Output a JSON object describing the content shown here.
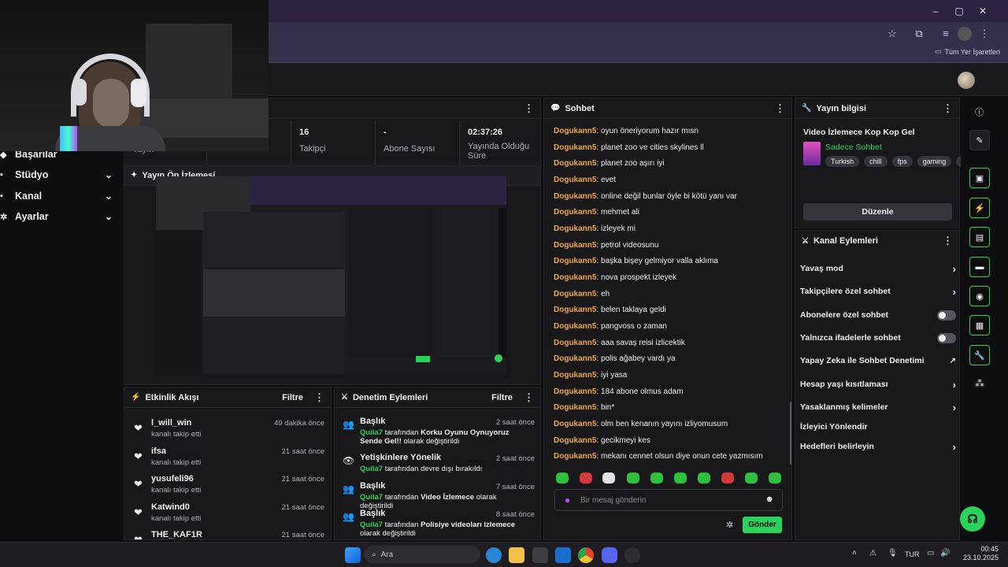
{
  "browser": {
    "bookmarks_label": "Tüm Yer İşaretleri",
    "minimize": "–",
    "maximize": "▢",
    "close": "✕"
  },
  "sidebar": {
    "items": [
      {
        "label": "Başarılar",
        "icon": "trophy-icon"
      },
      {
        "label": "Stüdyo",
        "icon": "studio-icon"
      },
      {
        "label": "Kanal",
        "icon": "channel-icon"
      },
      {
        "label": "Ayarlar",
        "icon": "gear-icon"
      }
    ]
  },
  "stats": {
    "items": [
      {
        "value": "",
        "label": "Yayın"
      },
      {
        "value": "16",
        "label": "Takipçi"
      },
      {
        "value": "-",
        "label": "Abone Sayısı"
      },
      {
        "value": "02:37:26",
        "label": "Yayında Olduğu Süre"
      }
    ]
  },
  "preview": {
    "title": "Yayın Ön İzlemesi"
  },
  "activity": {
    "title": "Etkinlik Akışı",
    "filter": "Filtre",
    "events": [
      {
        "name": "l_will_win",
        "sub": "kanalı takip etti",
        "time": "49 dakika önce"
      },
      {
        "name": "ifsa",
        "sub": "kanalı takip etti",
        "time": "21 saat önce"
      },
      {
        "name": "yusufeli96",
        "sub": "kanalı takip etti",
        "time": "21 saat önce"
      },
      {
        "name": "Katwind0",
        "sub": "kanalı takip etti",
        "time": "21 saat önce"
      },
      {
        "name": "THE_KAF1R",
        "sub": "",
        "time": "21 saat önce"
      }
    ]
  },
  "mod": {
    "title": "Denetim Eylemleri",
    "filter": "Filtre",
    "items": [
      {
        "title": "Başlık",
        "user": "Quila7",
        "by": "tarafından",
        "value": "Korku Oyunu Oynuyoruz Sende Gel!!",
        "tail": "olarak değiştirildi",
        "time": "2 saat önce"
      },
      {
        "title": "Yetişkinlere Yönelik",
        "user": "Quila7",
        "by": "tarafından devre dışı bırakıldı",
        "value": "",
        "tail": "",
        "time": "2 saat önce"
      },
      {
        "title": "Başlık",
        "user": "Quila7",
        "by": "tarafından",
        "value": "Video İzlemece",
        "tail": "olarak değiştirildi",
        "time": "7 saat önce"
      },
      {
        "title": "Başlık",
        "user": "Quila7",
        "by": "tarafından",
        "value": "Polisiye videoları izlemece",
        "tail": "olarak değiştirildi",
        "time": "8 saat önce"
      }
    ]
  },
  "chat": {
    "title": "Sohbet",
    "placeholder": "Bir mesaj gönderin",
    "send_label": "Gönder",
    "messages": [
      {
        "user": "Dogukann5",
        "text": "oyun öneriyorum hazır mısn"
      },
      {
        "user": "Dogukann5",
        "text": "planet zoo ve cities skylines ll"
      },
      {
        "user": "Dogukann5",
        "text": "planet zoo aşırı iyi"
      },
      {
        "user": "Dogukann5",
        "text": "evet"
      },
      {
        "user": "Dogukann5",
        "text": "online değil bunlar öyle bi kötü yanı var"
      },
      {
        "user": "Dogukann5",
        "text": "mehmet ali"
      },
      {
        "user": "Dogukann5",
        "text": "izleyek mi"
      },
      {
        "user": "Dogukann5",
        "text": "petrol videosunu"
      },
      {
        "user": "Dogukann5",
        "text": "başka bişey gelmiyor valla aklıma"
      },
      {
        "user": "Dogukann5",
        "text": "nova prospekt izleyek"
      },
      {
        "user": "Dogukann5",
        "text": "eh"
      },
      {
        "user": "Dogukann5",
        "text": "belen taklaya geldi"
      },
      {
        "user": "Dogukann5",
        "text": "pangvoss o zaman"
      },
      {
        "user": "Dogukann5",
        "text": "aaa savaş reisi izlicektik"
      },
      {
        "user": "Dogukann5",
        "text": "polis ağabey vardı ya"
      },
      {
        "user": "Dogukann5",
        "text": "iyi yasa"
      },
      {
        "user": "Dogukann5",
        "text": "184 abone olmus adam"
      },
      {
        "user": "Dogukann5",
        "text": "bin*"
      },
      {
        "user": "Dogukann5",
        "text": "olm ben kenanın yayını izliyomusum"
      },
      {
        "user": "Dogukann5",
        "text": "gecikmeyi kes"
      },
      {
        "user": "Dogukann5",
        "text": "mekanı cennet olsun diye onun cete yazmısım"
      }
    ]
  },
  "stream_info": {
    "title": "Yayın bilgisi",
    "stream_title": "Video İzlemece Kop Kop Gel",
    "category": "Sadece Sohbet",
    "tags": [
      "Turkish",
      "chill",
      "fps",
      "gaming",
      "Ti"
    ],
    "edit_label": "Düzenle"
  },
  "channel_actions": {
    "title": "Kanal Eylemleri",
    "items": [
      {
        "label": "Yavaş mod",
        "control": "chevron"
      },
      {
        "label": "Takipçilere özel sohbet",
        "control": "chevron"
      },
      {
        "label": "Abonelere özel sohbet",
        "control": "toggle"
      },
      {
        "label": "Yalnızca ifadelerle sohbet",
        "control": "toggle"
      },
      {
        "label": "Yapay Zeka ile Sohbet Denetimi",
        "control": "external"
      },
      {
        "label": "Hesap yaşı kısıtlaması",
        "control": "chevron"
      },
      {
        "label": "Yasaklanmış kelimeler",
        "control": "chevron"
      },
      {
        "label": "İzleyici Yönlendir",
        "control": "none"
      },
      {
        "label": "Hedefleri belirleyin",
        "control": "chevron"
      }
    ]
  },
  "taskbar": {
    "search_label": "Ara",
    "lang": "TUR",
    "time": "00:45",
    "date": "23.10.2025"
  },
  "colors": {
    "accent": "#2bd25b",
    "chat_user": "#f0a740",
    "panel_bg": "#18181b",
    "page_bg": "#0e0e10"
  }
}
